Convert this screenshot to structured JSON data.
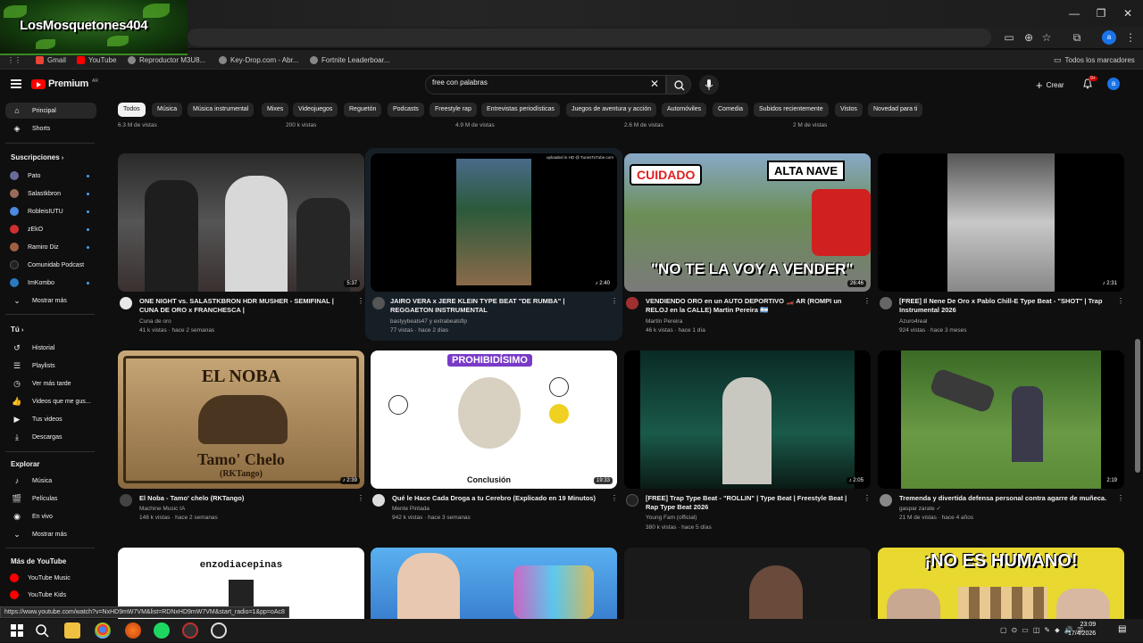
{
  "overlay": {
    "logo_text": "LosMosquetones404"
  },
  "window": {
    "minimize": "—",
    "restore": "❐",
    "close": "✕"
  },
  "bookmarks": {
    "items": [
      {
        "label": "Gmail",
        "color": "#ea4335"
      },
      {
        "label": "YouTube",
        "color": "#ff0000"
      },
      {
        "label": "Reproductor M3U8...",
        "color": "#888888"
      },
      {
        "label": "Key-Drop.com - Abr...",
        "color": "#888888"
      },
      {
        "label": "Fortnite Leaderboar...",
        "color": "#888888"
      }
    ],
    "all_bookmarks": "Todos los marcadores"
  },
  "header": {
    "logo_word": "Premium",
    "logo_region": "AR",
    "search_value": "free con palabras",
    "create_label": "Crear",
    "notif_count": "9+",
    "avatar_letter": "a"
  },
  "chips": [
    "Todos",
    "Música",
    "Música instrumental",
    "Mixes",
    "Videojuegos",
    "Reguetón",
    "Podcasts",
    "Freestyle rap",
    "Entrevistas periodísticas",
    "Juegos de aventura y acción",
    "Automóviles",
    "Comedia",
    "Subidos recientemente",
    "Vistos",
    "Novedad para ti"
  ],
  "sidebar": {
    "main": [
      {
        "label": "Principal",
        "icon": "home-icon",
        "glyph": "⌂"
      },
      {
        "label": "Shorts",
        "icon": "shorts-icon",
        "glyph": "◈"
      }
    ],
    "subs_title": "Suscripciones",
    "subs": [
      {
        "label": "Pato",
        "color": "#6b6b9a"
      },
      {
        "label": "Salastkbron",
        "color": "#9a6b5a"
      },
      {
        "label": "RobleisIUTU",
        "color": "#4a8adf"
      },
      {
        "label": "zEkO",
        "color": "#d03030"
      },
      {
        "label": "Ramiro Diz",
        "color": "#a06040"
      },
      {
        "label": "Comunidab Podcast",
        "color": "#222222"
      },
      {
        "label": "ImKombo",
        "color": "#2a7ac0"
      }
    ],
    "show_more": "Mostrar más",
    "you_title": "Tú",
    "you": [
      {
        "label": "Historial",
        "glyph": "↺"
      },
      {
        "label": "Playlists",
        "glyph": "☰"
      },
      {
        "label": "Ver más tarde",
        "glyph": "◷"
      },
      {
        "label": "Videos que me gus...",
        "glyph": "👍"
      },
      {
        "label": "Tus videos",
        "glyph": "▶"
      },
      {
        "label": "Descargas",
        "glyph": "⤓"
      }
    ],
    "explore_title": "Explorar",
    "explore": [
      {
        "label": "Música",
        "glyph": "♪"
      },
      {
        "label": "Películas",
        "glyph": "🎬"
      },
      {
        "label": "En vivo",
        "glyph": "◉"
      }
    ],
    "show_more2": "Mostrar más",
    "more_title": "Más de YouTube",
    "more": [
      {
        "label": "YouTube Music",
        "color": "#ff0000"
      },
      {
        "label": "YouTube Kids",
        "color": "#ff0000"
      }
    ]
  },
  "top_views": [
    "6.3 M de vistas",
    "200 k vistas",
    "4.9 M de vistas",
    "2.6 M de vistas",
    "2 M de vistas"
  ],
  "videos": [
    {
      "title": "ONE NIGHT vs. SALASTKBRON HDR MUSHER - SEMIFINAL | CUNA DE ORO x FRANCHESCA |",
      "channel": "Cuna de oro",
      "meta": "41 k vistas · hace 2 semanas",
      "duration": "5:37",
      "thumb": "#3a3a3a",
      "avatar": "#e8e8e8"
    },
    {
      "title": "JAIRO VERA x JERE KLEIN TYPE BEAT \"DE RUMBA\" | REGGAETON INSTRUMENTAL",
      "channel": "bastyybeats47 y extrabeatsflp",
      "meta": "77 vistas · hace 2 días",
      "duration": "♪ 2:40",
      "thumb": "#000000",
      "avatar": "#555555",
      "overlay": "uploaded in HD @ TunesToTube.com"
    },
    {
      "title": "VENDIENDO ORO en un AUTO DEPORTIVO 🏎️ AR (ROMPI un RELOJ en la CALLE) Martin Pereira 🇦🇷",
      "channel": "Martín Pereira",
      "meta": "46 k vistas · hace 1 día",
      "duration": "26:46",
      "thumb": "#6b8e55",
      "avatar": "#a03030",
      "tag1": "CUIDADO",
      "tag2": "ALTA NAVE",
      "caption": "\"NO TE LA VOY A VENDER\""
    },
    {
      "title": "[FREE] Il Nene De Oro x Pablo Chill-E Type Beat - \"SHOT\" | Trap Instrumental 2026",
      "channel": "Azuro4real",
      "meta": "924 vistas · hace 3 meses",
      "duration": "♪ 2:31",
      "thumb": "#000000",
      "avatar": "#666666"
    },
    {
      "title": "El Noba - Tamo' chelo (RKTango)",
      "channel": "Machine Music IA",
      "meta": "148 k vistas · hace 2 semanas",
      "duration": "♪ 2:39",
      "thumb": "#6b5030",
      "avatar": "#444444",
      "poster_title": "EL NOBA",
      "poster_sub": "Tamo' Chelo",
      "poster_sub2": "(RKTango)"
    },
    {
      "title": "Qué le Hace Cada Droga a tu Cerebro (Explicado en 19 Minutos)",
      "channel": "Mente Pintada",
      "meta": "942 k vistas · hace 3 semanas",
      "duration": "19:33",
      "thumb": "#ffffff",
      "avatar": "#dddddd",
      "banner": "PROHIBIDÍSIMO",
      "footer": "Conclusión"
    },
    {
      "title": "[FREE] Trap Type Beat - \"ROLLIN\" | Type Beat | Freestyle Beat | Rap Type Beat 2026",
      "channel": "Young Fam (official)",
      "meta": "380 k vistas · hace 5 días",
      "duration": "♪ 2:05",
      "thumb": "#0d3a35",
      "avatar": "#222222"
    },
    {
      "title": "Tremenda y divertida defensa personal contra agarre de muñeca.",
      "channel": "gaspar zarate ✓",
      "meta": "21 M de vistas · hace 4 años",
      "duration": "2:19",
      "thumb": "#4a7a35",
      "avatar": "#888888"
    }
  ],
  "bottom_row": [
    {
      "label": "enzodiacepinas",
      "bg": "#ffffff"
    },
    {
      "label": "",
      "bg": "#4aa0e0"
    },
    {
      "label": "",
      "bg": "#1a1a1a"
    },
    {
      "label": "¡NO ES HUMANO!",
      "bg": "#e8d830"
    }
  ],
  "status_url": "https://www.youtube.com/watch?v=NxHD9mW7VM&list=RDNxHD9mW7VM&start_radio=1&pp=oAc8",
  "taskbar": {
    "time": "23:09",
    "date": "17/4/2026"
  }
}
